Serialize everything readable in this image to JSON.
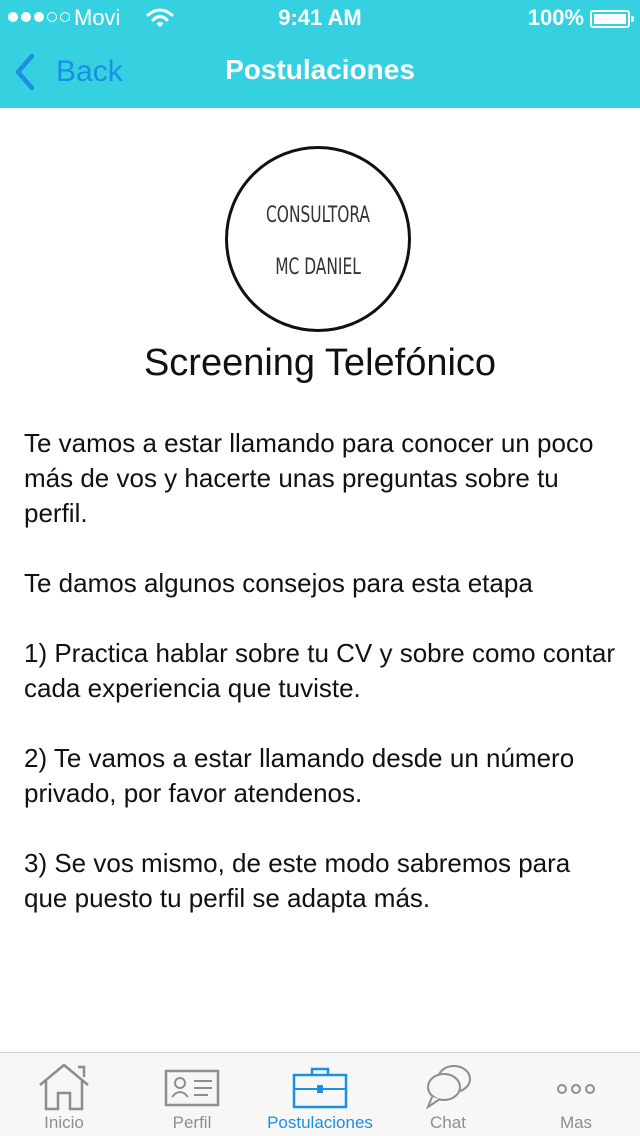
{
  "status_bar": {
    "carrier": "Movi",
    "time": "9:41 AM",
    "battery": "100%"
  },
  "nav": {
    "back_label": "Back",
    "title": "Postulaciones"
  },
  "logo": {
    "line1": "CONSULTORA",
    "line2": "MC DANIEL"
  },
  "content": {
    "title": "Screening Telefónico",
    "paragraphs": [
      "Te vamos a estar llamando para conocer un poco más de vos y hacerte unas preguntas sobre tu perfil.",
      "Te damos algunos consejos para esta etapa",
      "1) Practica hablar sobre tu CV y sobre como contar cada experiencia que tuviste.",
      "2) Te vamos a estar llamando desde un número privado, por favor atendenos.",
      "3) Se vos mismo, de este modo sabremos para que puesto tu perfil se adapta más."
    ]
  },
  "tabs": [
    {
      "label": "Inicio",
      "icon": "home-icon"
    },
    {
      "label": "Perfil",
      "icon": "id-card-icon"
    },
    {
      "label": "Postulaciones",
      "icon": "briefcase-icon",
      "active": true
    },
    {
      "label": "Chat",
      "icon": "chat-bubbles-icon"
    },
    {
      "label": "Mas",
      "icon": "more-dots-icon"
    }
  ],
  "colors": {
    "header": "#36d1e0",
    "accent": "#1a8fe3",
    "inactive_tab": "#8e8e8e"
  }
}
